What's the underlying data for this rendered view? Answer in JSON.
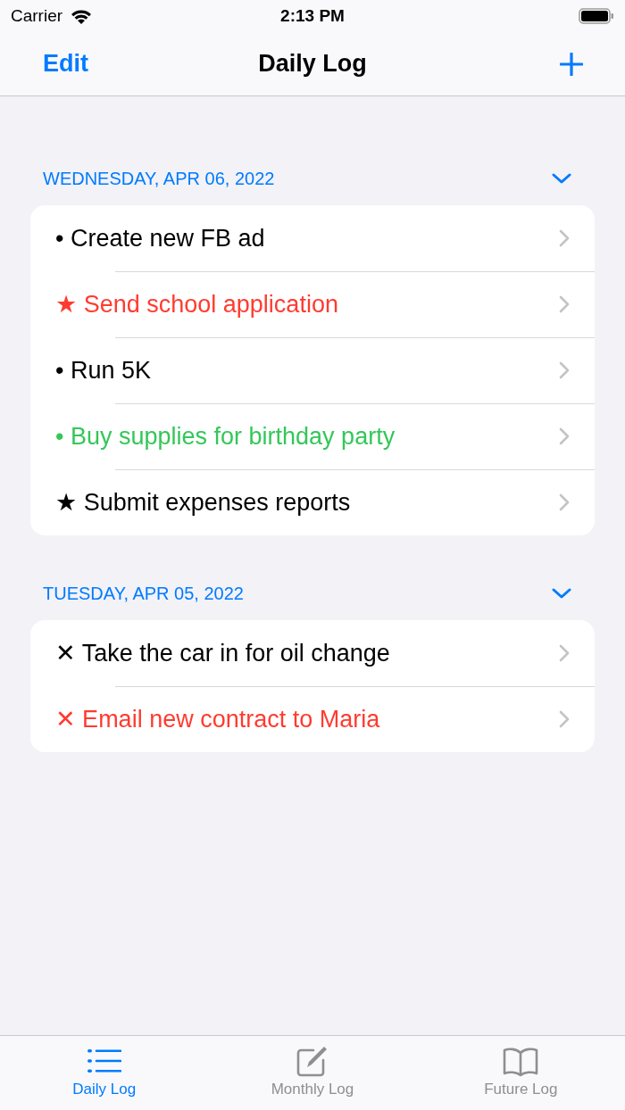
{
  "status_bar": {
    "carrier": "Carrier",
    "time": "2:13 PM"
  },
  "nav": {
    "left": "Edit",
    "title": "Daily Log"
  },
  "sections": [
    {
      "header": "WEDNESDAY, APR 06, 2022",
      "expanded": true,
      "items": [
        {
          "text": "• Create new FB ad",
          "color": "#000000"
        },
        {
          "text": "★ Send school application",
          "color": "#ff3b30"
        },
        {
          "text": "• Run 5K",
          "color": "#000000"
        },
        {
          "text": "• Buy supplies for birthday party",
          "color": "#34c759"
        },
        {
          "text": "★ Submit expenses reports",
          "color": "#000000"
        }
      ]
    },
    {
      "header": "TUESDAY, APR 05, 2022",
      "expanded": true,
      "items": [
        {
          "text": "✕ Take the car in for oil change",
          "color": "#000000"
        },
        {
          "text": "✕ Email new contract to Maria",
          "color": "#ff3b30"
        }
      ]
    }
  ],
  "tabs": [
    {
      "label": "Daily Log",
      "kind": "list",
      "selected": true
    },
    {
      "label": "Monthly Log",
      "kind": "compose",
      "selected": false
    },
    {
      "label": "Future Log",
      "kind": "book",
      "selected": false
    }
  ]
}
